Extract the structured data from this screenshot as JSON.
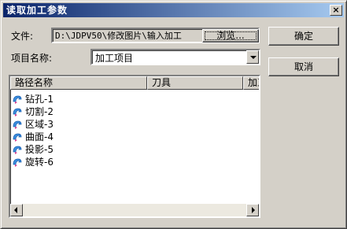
{
  "dialog": {
    "title": "读取加工参数",
    "close_label": "×"
  },
  "file": {
    "label": "文件:",
    "path": "D:\\JDPV50\\修改图片\\输入加工",
    "browse_label": "浏览..."
  },
  "project": {
    "label": "项目名称:",
    "selected": "加工项目"
  },
  "buttons": {
    "ok": "确定",
    "cancel": "取消"
  },
  "list": {
    "columns": [
      "路径名称",
      "刀具",
      "加工"
    ],
    "rows": [
      "钻孔-1",
      "切割-2",
      "区域-3",
      "曲面-4",
      "投影-5",
      "旋转-6"
    ]
  }
}
